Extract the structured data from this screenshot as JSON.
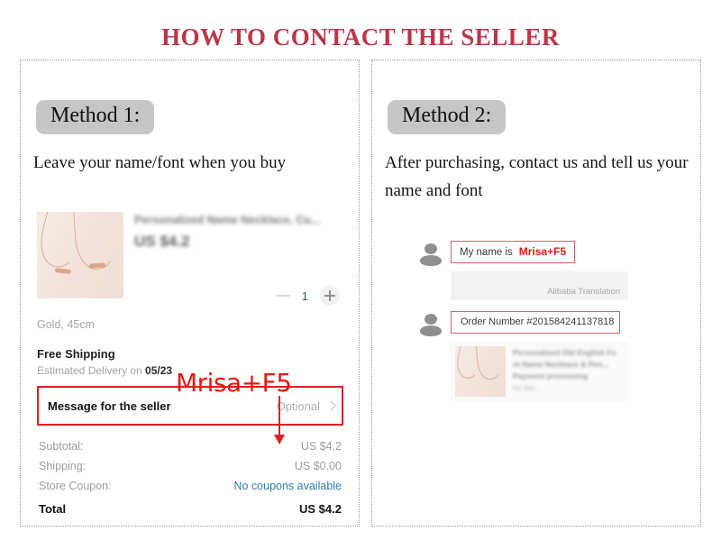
{
  "title": "HOW TO CONTACT THE SELLER",
  "colors": {
    "title_red": "#b8394a",
    "annotation_red": "#e01b12",
    "badge_gray": "#c6c6c6",
    "link_blue": "#2f7fa8"
  },
  "method1": {
    "badge": "Method 1:",
    "description": "Leave your name/font when you buy",
    "checkout": {
      "product_title": "Personalized Name Necklace, Cu...",
      "product_price": "US $4.2",
      "quantity": "1",
      "variant": "Gold, 45cm",
      "shipping_title": "Free Shipping",
      "shipping_sub_prefix": "Estimated Delivery on ",
      "shipping_date": "05/23",
      "message_label": "Message for the seller",
      "message_placeholder": "Optional",
      "totals": [
        {
          "label": "Subtotal:",
          "value": "US $4.2",
          "link": false
        },
        {
          "label": "Shipping:",
          "value": "US $0.00",
          "link": false
        },
        {
          "label": "Store Coupon:",
          "value": "No coupons available",
          "link": true
        }
      ],
      "grand_total_label": "Total",
      "grand_total_value": "US $4.2"
    },
    "annotation": {
      "text": "Mrisa+F5"
    }
  },
  "method2": {
    "badge": "Method 2:",
    "description": "After purchasing, contact us and tell us your name and font",
    "chat": {
      "message_prefix": "My name is",
      "message_highlight": "Mrisa+F5",
      "translation_label": "Alibaba Translation",
      "order_message": "Order Number #201584241137818",
      "order_card_lines": [
        "Personalized Old English Fo",
        "nt Name Necklace & Pen...",
        "Payment processing",
        "for fee..."
      ]
    }
  }
}
